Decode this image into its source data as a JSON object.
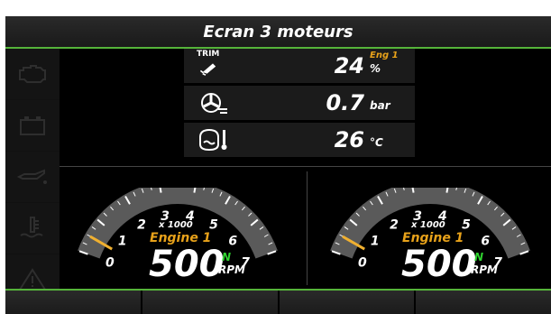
{
  "title": "Ecran 3 moteurs",
  "sidebar": {
    "items": [
      {
        "icon": "engine-warning-icon"
      },
      {
        "icon": "battery-icon"
      },
      {
        "icon": "oil-pressure-icon"
      },
      {
        "icon": "coolant-temperature-icon"
      },
      {
        "icon": "warning-triangle-icon"
      }
    ]
  },
  "metrics": {
    "trim": {
      "label": "TRIM",
      "value": "24",
      "unit": "%",
      "engine_tag": "Eng 1"
    },
    "boost": {
      "value": "0.7",
      "unit": "bar"
    },
    "temperature": {
      "value": "26",
      "unit": "°C"
    }
  },
  "gauges": [
    {
      "multiplier": "x 1000",
      "engine_label": "Engine 1",
      "rpm": "500",
      "gear": "N",
      "rpm_label": "RPM",
      "rpm_fraction": 0.071,
      "ticks": [
        "0",
        "1",
        "2",
        "3",
        "4",
        "5",
        "6",
        "7"
      ]
    },
    {
      "multiplier": "x 1000",
      "engine_label": "Engine 1",
      "rpm": "500",
      "gear": "N",
      "rpm_label": "RPM",
      "rpm_fraction": 0.071,
      "ticks": [
        "0",
        "1",
        "2",
        "3",
        "4",
        "5",
        "6",
        "7"
      ]
    }
  ],
  "bottom_bar": {
    "buttons": [
      "",
      "",
      "",
      ""
    ]
  },
  "colors": {
    "accent_green": "#55b43a",
    "engine_orange": "#e8a21a",
    "gear_green": "#2fd22f",
    "needle": "#f0b030"
  }
}
